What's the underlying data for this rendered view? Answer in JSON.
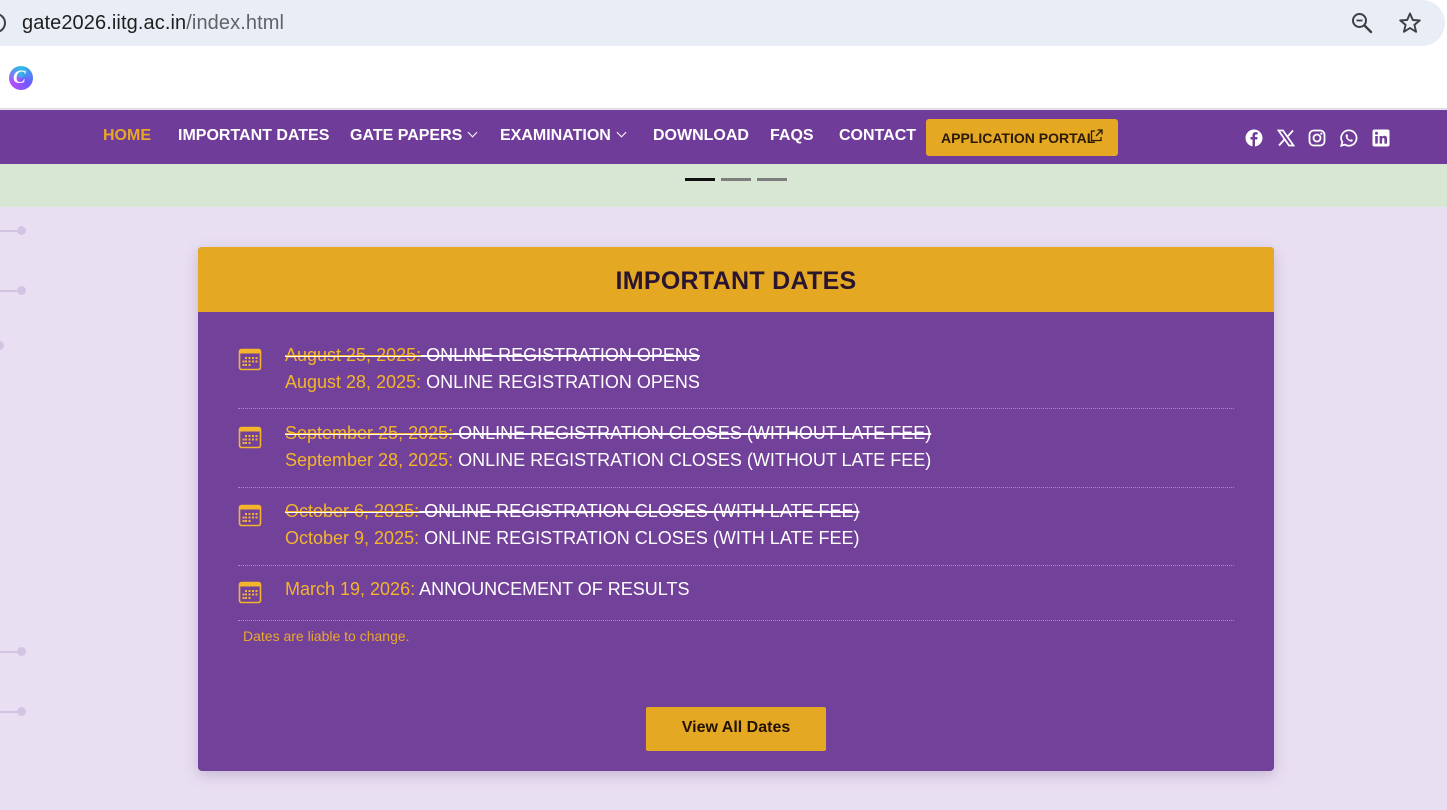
{
  "browser": {
    "url_host": "gate2026.iitg.ac.in",
    "url_path": "/index.html",
    "icons": [
      "zoom-icon",
      "star-icon"
    ],
    "extension_icon": "canva-icon",
    "extension_letter": "C"
  },
  "nav": {
    "items": [
      {
        "label": "HOME",
        "active": true,
        "dropdown": false
      },
      {
        "label": "IMPORTANT DATES",
        "active": false,
        "dropdown": false
      },
      {
        "label": "GATE PAPERS",
        "active": false,
        "dropdown": true
      },
      {
        "label": "EXAMINATION",
        "active": false,
        "dropdown": true
      },
      {
        "label": "DOWNLOAD",
        "active": false,
        "dropdown": false
      },
      {
        "label": "FAQS",
        "active": false,
        "dropdown": false
      },
      {
        "label": "CONTACT",
        "active": false,
        "dropdown": false
      }
    ],
    "portal_label": "APPLICATION PORTAL",
    "social": [
      "facebook-icon",
      "x-icon",
      "instagram-icon",
      "whatsapp-icon",
      "linkedin-icon"
    ]
  },
  "slider": {
    "slide_count": 3,
    "active_index": 0
  },
  "important_dates": {
    "title": "IMPORTANT DATES",
    "entries": [
      {
        "old": {
          "date": "August 25, 2025:",
          "event": "ONLINE REGISTRATION OPENS"
        },
        "new": {
          "date": "August 28, 2025:",
          "event": "ONLINE REGISTRATION OPENS"
        }
      },
      {
        "old": {
          "date": "September 25, 2025:",
          "event": "ONLINE REGISTRATION CLOSES (WITHOUT LATE FEE)"
        },
        "new": {
          "date": "September 28, 2025:",
          "event": "ONLINE REGISTRATION CLOSES (WITHOUT LATE FEE)"
        }
      },
      {
        "old": {
          "date": "October 6, 2025:",
          "event": "ONLINE REGISTRATION CLOSES (WITH LATE FEE)"
        },
        "new": {
          "date": "October 9, 2025:",
          "event": "ONLINE REGISTRATION CLOSES (WITH LATE FEE)"
        }
      },
      {
        "new": {
          "date": "March 19, 2026:",
          "event": "ANNOUNCEMENT OF RESULTS"
        }
      }
    ],
    "note": "Dates are liable to change.",
    "view_all_label": "View All Dates"
  },
  "colors": {
    "purple": "#72419a",
    "nav_purple": "#6f3d99",
    "gold": "#e4a823",
    "date_gold": "#f3b52b",
    "page_bg": "#e9dff2"
  }
}
